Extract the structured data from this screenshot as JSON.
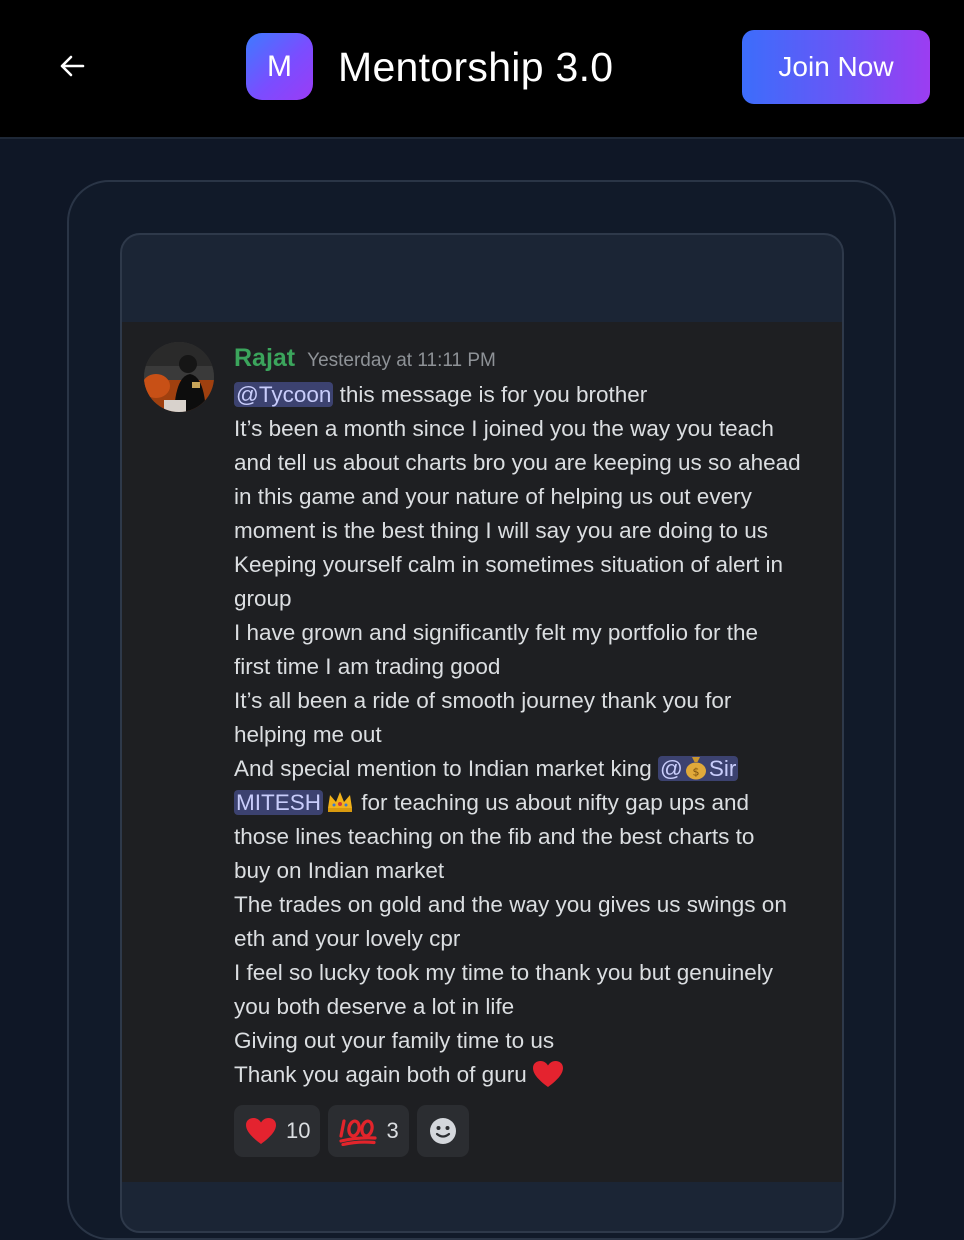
{
  "header": {
    "logo_letter": "M",
    "title": "Mentorship 3.0",
    "join_label": "Join Now"
  },
  "message": {
    "author": "Rajat",
    "author_color": "#3ba55c",
    "timestamp": "Yesterday at 11:11 PM",
    "mention_tycoon": "@Tycoon",
    "line1_rest": " this message is for you brother",
    "line2": "It’s been a month since I joined you the way you teach",
    "line3": "and tell us about charts bro you are keeping us so ahead",
    "line4": "in this game and your nature of helping us out every",
    "line5": "moment is the best thing I will say you are doing to us",
    "line6": "Keeping yourself calm in sometimes situation of alert in",
    "line7": "group",
    "line8": "I have grown and significantly felt my portfolio for the",
    "line9": "first time I am trading good",
    "line10": "It’s all been a ride of smooth journey thank you for",
    "line11": "helping me out",
    "line12_pre": "And special mention to Indian market king ",
    "mention_sir_at": "@",
    "mention_sir_rest": "Sir",
    "mention_mitesh": "MITESH",
    "line13_rest": " for teaching us about nifty gap ups and",
    "line14": "those lines teaching on the fib and the best charts to",
    "line15": "buy on Indian market",
    "line16": "The trades on gold and the way you gives us swings on",
    "line17": "eth and your lovely cpr",
    "line18": "I feel so lucky took my time to thank you but genuinely",
    "line19": "you both deserve a lot in life",
    "line20": "Giving out your family time to us",
    "line21": "Thank you again both of guru"
  },
  "reactions": [
    {
      "icon": "heart-icon",
      "count": "10"
    },
    {
      "icon": "hundred-points-icon",
      "count": "3"
    },
    {
      "icon": "add-reaction-icon",
      "count": ""
    }
  ]
}
